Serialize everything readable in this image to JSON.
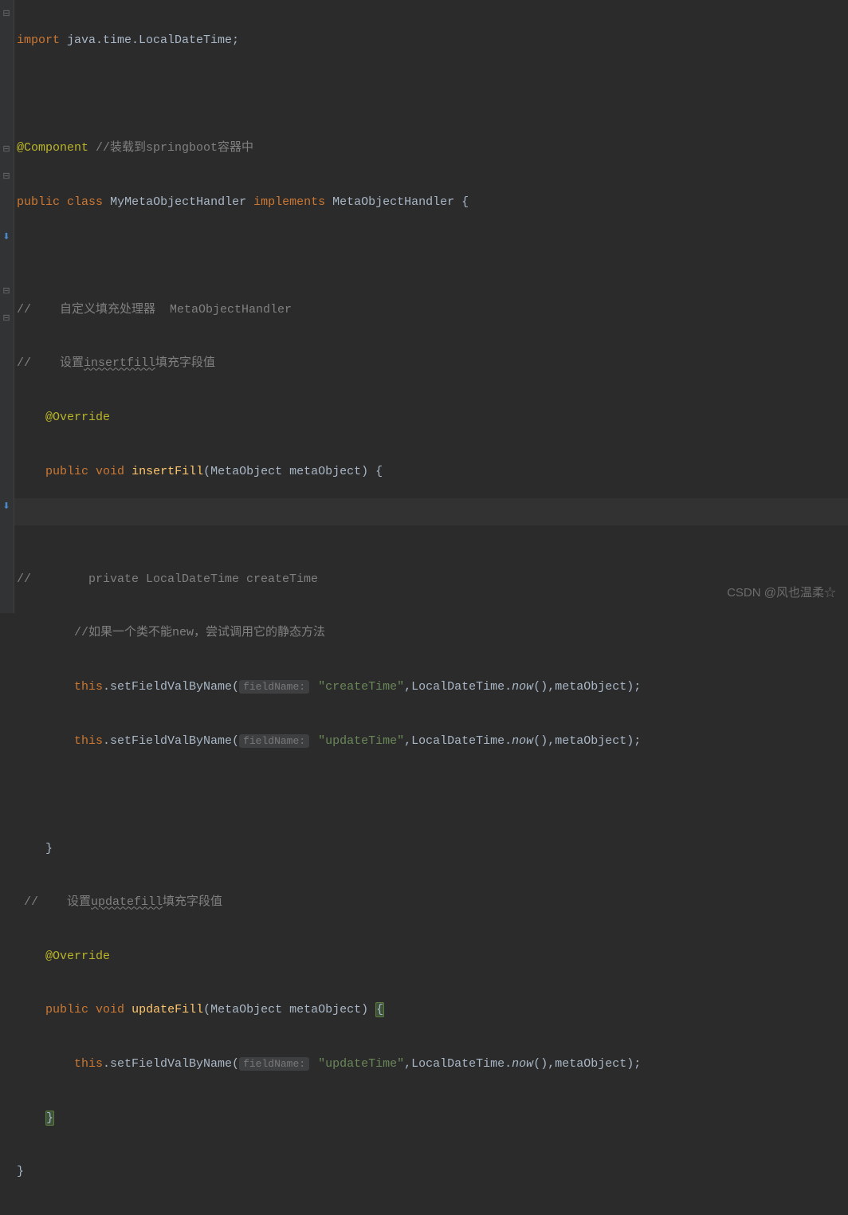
{
  "code": {
    "import_kw": "import",
    "import_pkg": " java.time.LocalDateTime;",
    "anno_component": "@Component",
    "comment_component": " //装载到springboot容器中",
    "public_kw": "public",
    "class_kw": "class",
    "classname": "MyMetaObjectHandler",
    "implements_kw": "implements",
    "interface": "MetaObjectHandler",
    "brace_open": " {",
    "comment_handler": "//    自定义填充处理器  MetaObjectHandler",
    "comment_insert_pre": "//    设置",
    "comment_insert_mid": "insertfill",
    "comment_insert_post": "填充字段值",
    "anno_override": "@Override",
    "void_kw": "void",
    "insertfill": "insertFill",
    "param_type": "MetaObject",
    "param_name": "metaObject",
    "paren_brace": ") {",
    "comment_private": "//        private LocalDateTime createTime",
    "comment_new": "//如果一个类不能new，尝试调用它的静态方法",
    "this_kw": "this",
    "setfield": ".setFieldValByName(",
    "hint_fieldname": "fieldName:",
    "str_create": "\"createTime\"",
    "str_update": "\"updateTime\"",
    "comma": ",",
    "ldt": "LocalDateTime.",
    "now": "now",
    "paren_close": "()",
    "metaobj": ",metaObject);",
    "brace_close": "}",
    "comment_update_pre": "//    设置",
    "comment_update_mid": "updatefill",
    "comment_update_post": "填充字段值",
    "updatefill": "updateFill",
    "paren_open": "("
  },
  "watermark": "CSDN @风也温柔☆"
}
